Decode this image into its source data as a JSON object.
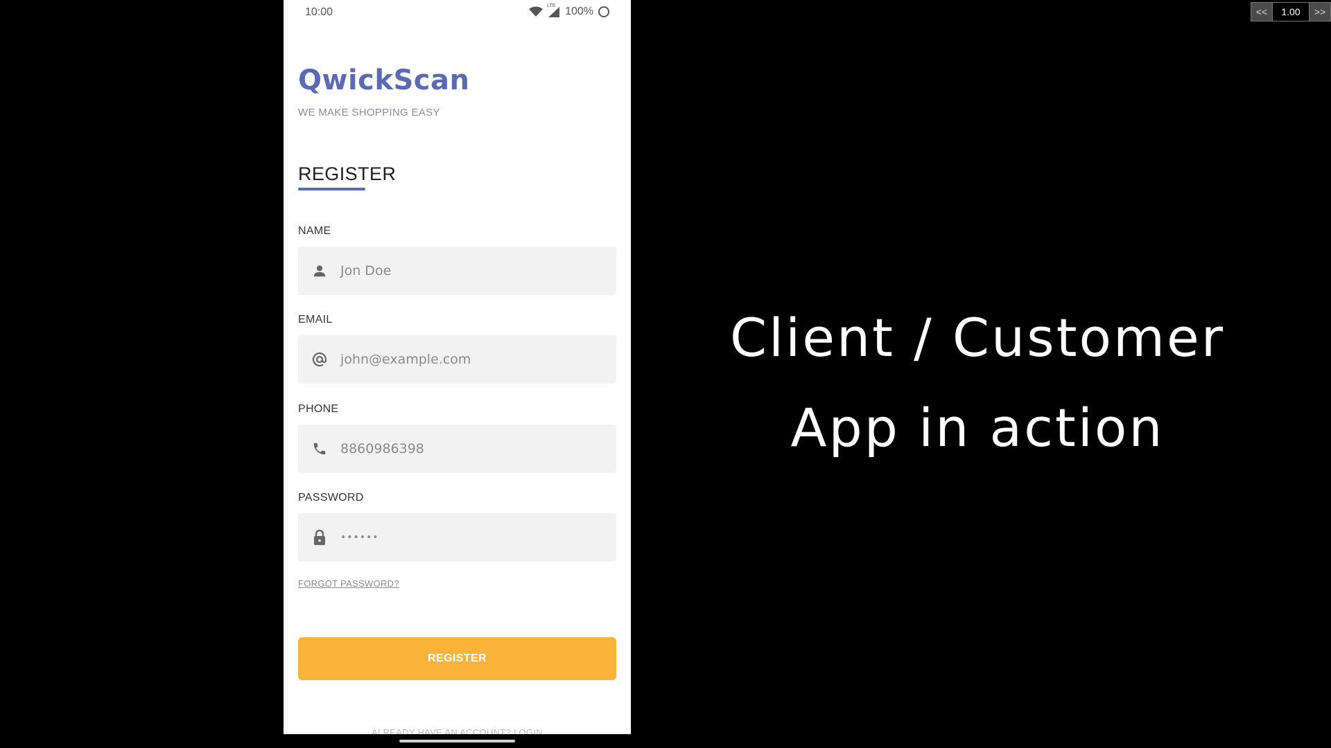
{
  "status_bar": {
    "time": "10:00",
    "network_label": "LTE",
    "battery": "100%",
    "icons": [
      "wifi-icon",
      "signal-icon",
      "battery-circle-icon"
    ]
  },
  "app": {
    "brand": "QwickScan",
    "tagline": "WE MAKE SHOPPING EASY",
    "page_title": "REGISTER",
    "accent_color": "#5a6bb3",
    "button_color": "#fbb43a"
  },
  "form": {
    "fields": [
      {
        "label": "NAME",
        "value": "Jon Doe",
        "icon": "person-icon"
      },
      {
        "label": "EMAIL",
        "value": "john@example.com",
        "icon": "at-icon"
      },
      {
        "label": "PHONE",
        "value": "8860986398",
        "icon": "phone-icon"
      },
      {
        "label": "PASSWORD",
        "value": "••••••",
        "icon": "lock-icon"
      }
    ],
    "forgot_password": "FORGOT PASSWORD?",
    "register_button": "REGISTER",
    "login_link": "ALREADY HAVE AN ACCOUNT? LOGIN"
  },
  "overlay": {
    "line1": "Client / Customer",
    "line2": "App in action"
  },
  "player": {
    "prev_label": "<<",
    "speed": "1.00",
    "next_label": ">>"
  }
}
